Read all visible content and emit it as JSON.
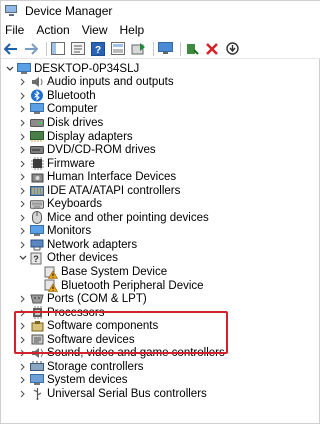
{
  "window": {
    "title": "Device Manager"
  },
  "menu": {
    "file": "File",
    "action": "Action",
    "view": "View",
    "help": "Help"
  },
  "tree": {
    "root": "DESKTOP-0P34SLJ",
    "categories": [
      {
        "label": "Audio inputs and outputs",
        "icon": "speaker-icon"
      },
      {
        "label": "Bluetooth",
        "icon": "bluetooth-icon"
      },
      {
        "label": "Computer",
        "icon": "computer-icon"
      },
      {
        "label": "Disk drives",
        "icon": "disk-drive-icon"
      },
      {
        "label": "Display adapters",
        "icon": "display-adapter-icon"
      },
      {
        "label": "DVD/CD-ROM drives",
        "icon": "dvd-drive-icon"
      },
      {
        "label": "Firmware",
        "icon": "firmware-icon"
      },
      {
        "label": "Human Interface Devices",
        "icon": "hid-icon"
      },
      {
        "label": "IDE ATA/ATAPI controllers",
        "icon": "ide-controller-icon"
      },
      {
        "label": "Keyboards",
        "icon": "keyboard-icon"
      },
      {
        "label": "Mice and other pointing devices",
        "icon": "mouse-icon"
      },
      {
        "label": "Monitors",
        "icon": "monitor-icon"
      },
      {
        "label": "Network adapters",
        "icon": "network-adapter-icon"
      },
      {
        "label": "Other devices",
        "icon": "unknown-device-icon",
        "expanded": true,
        "children": [
          {
            "label": "Base System Device",
            "icon": "warning-device-icon"
          },
          {
            "label": "Bluetooth Peripheral Device",
            "icon": "warning-device-icon"
          }
        ]
      },
      {
        "label": "Ports (COM & LPT)",
        "icon": "port-icon"
      },
      {
        "label": "Processors",
        "icon": "processor-icon"
      },
      {
        "label": "Software components",
        "icon": "software-component-icon"
      },
      {
        "label": "Software devices",
        "icon": "software-device-icon"
      },
      {
        "label": "Sound, video and game controllers",
        "icon": "sound-icon"
      },
      {
        "label": "Storage controllers",
        "icon": "storage-controller-icon"
      },
      {
        "label": "System devices",
        "icon": "system-device-icon"
      },
      {
        "label": "Universal Serial Bus controllers",
        "icon": "usb-icon"
      }
    ]
  },
  "colors": {
    "highlight": "#d2232a",
    "warning": "#e8a317",
    "uninstall_red": "#d2232a",
    "enable_green": "#1e8a3a"
  }
}
